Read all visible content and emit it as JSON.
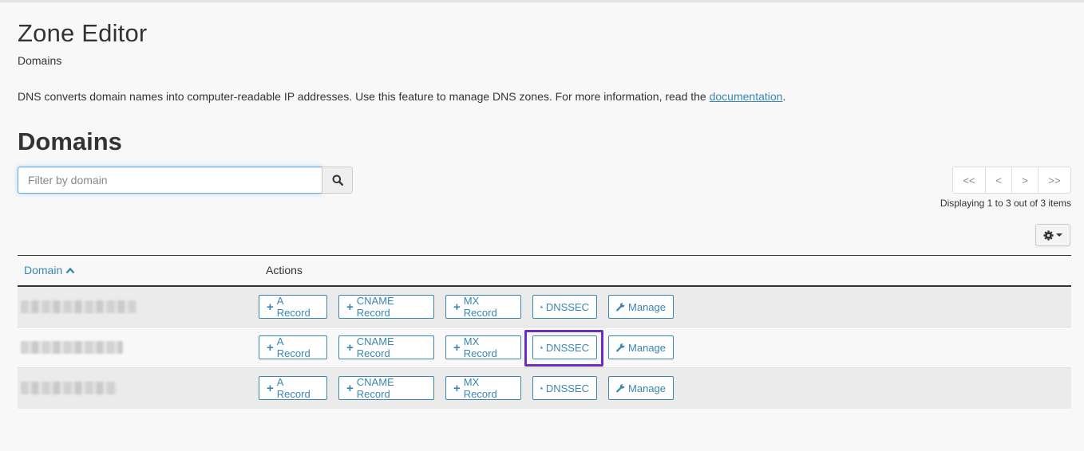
{
  "page": {
    "title": "Zone Editor",
    "subtitle": "Domains",
    "description_pre": "DNS converts domain names into computer-readable IP addresses. Use this feature to manage DNS zones. For more information, read the ",
    "description_link": "documentation",
    "description_post": ".",
    "section_title": "Domains"
  },
  "search": {
    "placeholder": "Filter by domain",
    "value": ""
  },
  "pagination": {
    "first": "<<",
    "prev": "<",
    "next": ">",
    "last": ">>",
    "displaying": "Displaying 1 to 3 out of 3 items"
  },
  "table": {
    "headers": {
      "domain": "Domain",
      "actions": "Actions"
    },
    "rows": [
      {
        "domain": "",
        "highlight": false
      },
      {
        "domain": "",
        "highlight": true
      },
      {
        "domain": "",
        "highlight": false
      }
    ],
    "action_labels": {
      "a_record": "A Record",
      "cname_record": "CNAME Record",
      "mx_record": "MX Record",
      "dnssec": "DNSSEC",
      "manage": "Manage"
    }
  },
  "colors": {
    "accent": "#3b86b0",
    "highlight": "#6b2fbf"
  },
  "icons": [
    "search-icon",
    "chevron-up-icon",
    "gear-icon",
    "plus-icon",
    "lock-icon",
    "wrench-icon"
  ]
}
